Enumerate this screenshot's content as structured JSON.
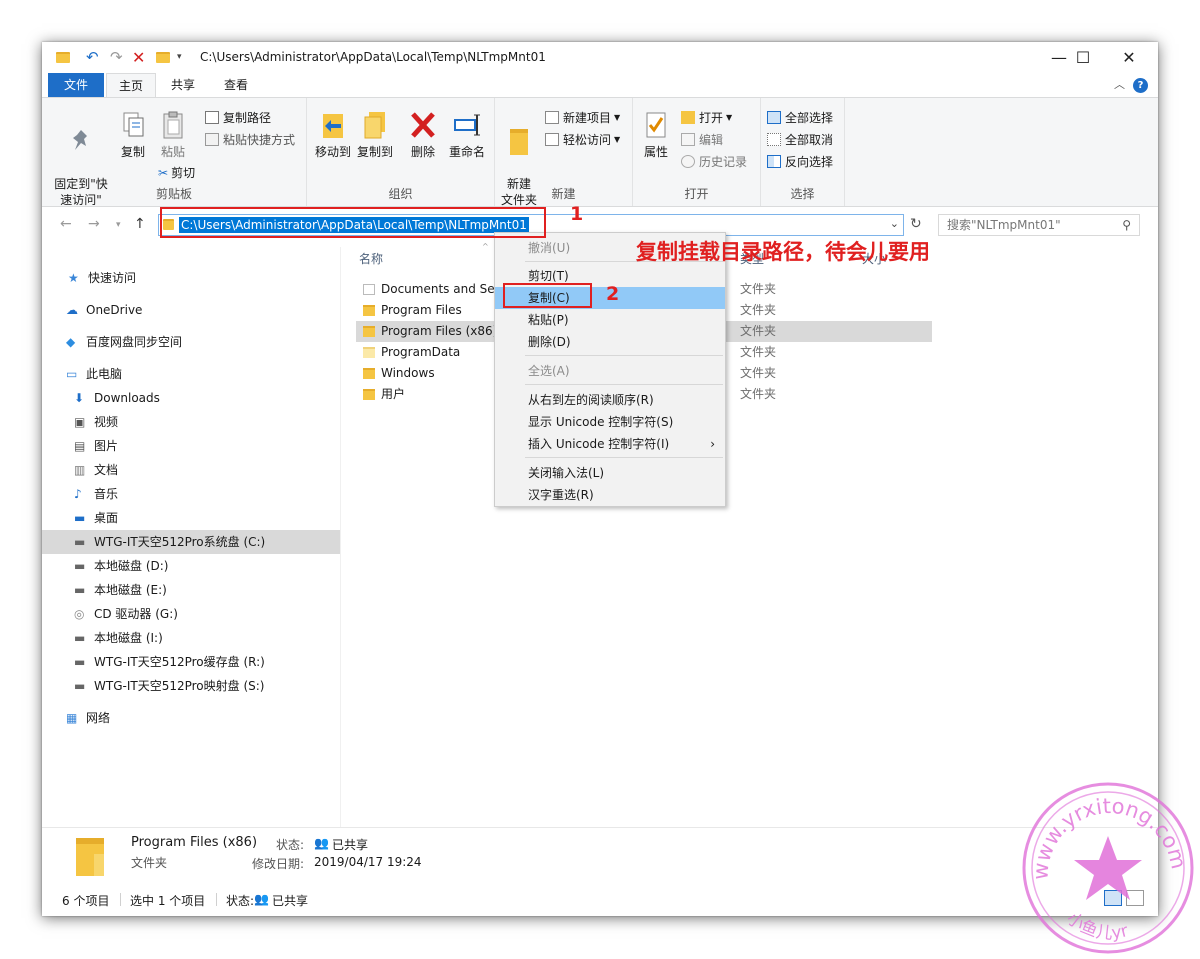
{
  "title": {
    "path": "C:\\Users\\Administrator\\AppData\\Local\\Temp\\NLTmpMnt01"
  },
  "window_controls": {
    "minimize": "—",
    "maximize": "☐",
    "close": "✕"
  },
  "tabs": [
    "文件",
    "主页",
    "共享",
    "查看"
  ],
  "ribbon": {
    "clipboard": {
      "pin": "固定到\"快\n速访问\"",
      "copy": "复制",
      "paste": "粘贴",
      "copy_path": "复制路径",
      "paste_shortcut": "粘贴快捷方式",
      "cut": "剪切",
      "label": "剪贴板"
    },
    "organize": {
      "move_to": "移动到",
      "copy_to": "复制到",
      "delete": "删除",
      "rename": "重命名",
      "label": "组织"
    },
    "new": {
      "new_folder": "新建\n文件夹",
      "new_item": "新建项目",
      "easy_access": "轻松访问",
      "label": "新建"
    },
    "open": {
      "properties": "属性",
      "open": "打开",
      "edit": "编辑",
      "history": "历史记录",
      "label": "打开"
    },
    "select": {
      "select_all": "全部选择",
      "select_none": "全部取消",
      "invert": "反向选择",
      "label": "选择"
    }
  },
  "address": {
    "value": "C:\\Users\\Administrator\\AppData\\Local\\Temp\\NLTmpMnt01",
    "search_placeholder": "搜索\"NLTmpMnt01\""
  },
  "nav": [
    {
      "label": "快速访问",
      "icon": "star-icon"
    },
    {
      "label": "OneDrive",
      "icon": "cloud-icon"
    },
    {
      "label": "百度网盘同步空间",
      "icon": "baidu-icon"
    },
    {
      "label": "此电脑",
      "icon": "computer-icon"
    },
    {
      "label": "Downloads",
      "icon": "download-icon"
    },
    {
      "label": "视频",
      "icon": "video-icon"
    },
    {
      "label": "图片",
      "icon": "picture-icon"
    },
    {
      "label": "文档",
      "icon": "document-icon"
    },
    {
      "label": "音乐",
      "icon": "music-icon"
    },
    {
      "label": "桌面",
      "icon": "desktop-icon"
    },
    {
      "label": "WTG-IT天空512Pro系统盘 (C:)",
      "icon": "drive-icon"
    },
    {
      "label": "本地磁盘 (D:)",
      "icon": "drive-icon"
    },
    {
      "label": "本地磁盘 (E:)",
      "icon": "drive-icon"
    },
    {
      "label": "CD 驱动器 (G:)",
      "icon": "cd-icon"
    },
    {
      "label": "本地磁盘 (I:)",
      "icon": "drive-icon"
    },
    {
      "label": "WTG-IT天空512Pro缓存盘 (R:)",
      "icon": "drive-icon"
    },
    {
      "label": "WTG-IT天空512Pro映射盘 (S:)",
      "icon": "drive-icon"
    },
    {
      "label": "网络",
      "icon": "network-icon"
    }
  ],
  "columns": {
    "name": "名称",
    "type": "类型",
    "size": "大小"
  },
  "files": [
    {
      "name": "Documents and Set",
      "type": "文件夹"
    },
    {
      "name": "Program Files",
      "type": "文件夹"
    },
    {
      "name": "Program Files (x86)",
      "type": "文件夹"
    },
    {
      "name": "ProgramData",
      "type": "文件夹"
    },
    {
      "name": "Windows",
      "type": "文件夹"
    },
    {
      "name": "用户",
      "type": "文件夹"
    }
  ],
  "context_menu": {
    "undo": "撤消(U)",
    "cut": "剪切(T)",
    "copy": "复制(C)",
    "paste": "粘贴(P)",
    "delete": "删除(D)",
    "select_all": "全选(A)",
    "rtl": "从右到左的阅读顺序(R)",
    "show_unicode": "显示 Unicode 控制字符(S)",
    "insert_unicode": "插入 Unicode 控制字符(I)",
    "close_ime": "关闭输入法(L)",
    "reconvert": "汉字重选(R)"
  },
  "details": {
    "name": "Program Files (x86)",
    "type": "文件夹",
    "status_label": "状态:",
    "status_value": "已共享",
    "modified_label": "修改日期:",
    "modified_value": "2019/04/17 19:24"
  },
  "statusbar": {
    "items": "6 个项目",
    "selected": "选中 1 个项目",
    "status_label": "状态:",
    "status_value": "已共享"
  },
  "annotations": {
    "step1": "1",
    "step2": "2",
    "note": "复制挂载目录路径，待会儿要用"
  },
  "watermark": {
    "text_top": "www.yrxitong.com",
    "text_bottom": "小鱼儿yr"
  }
}
